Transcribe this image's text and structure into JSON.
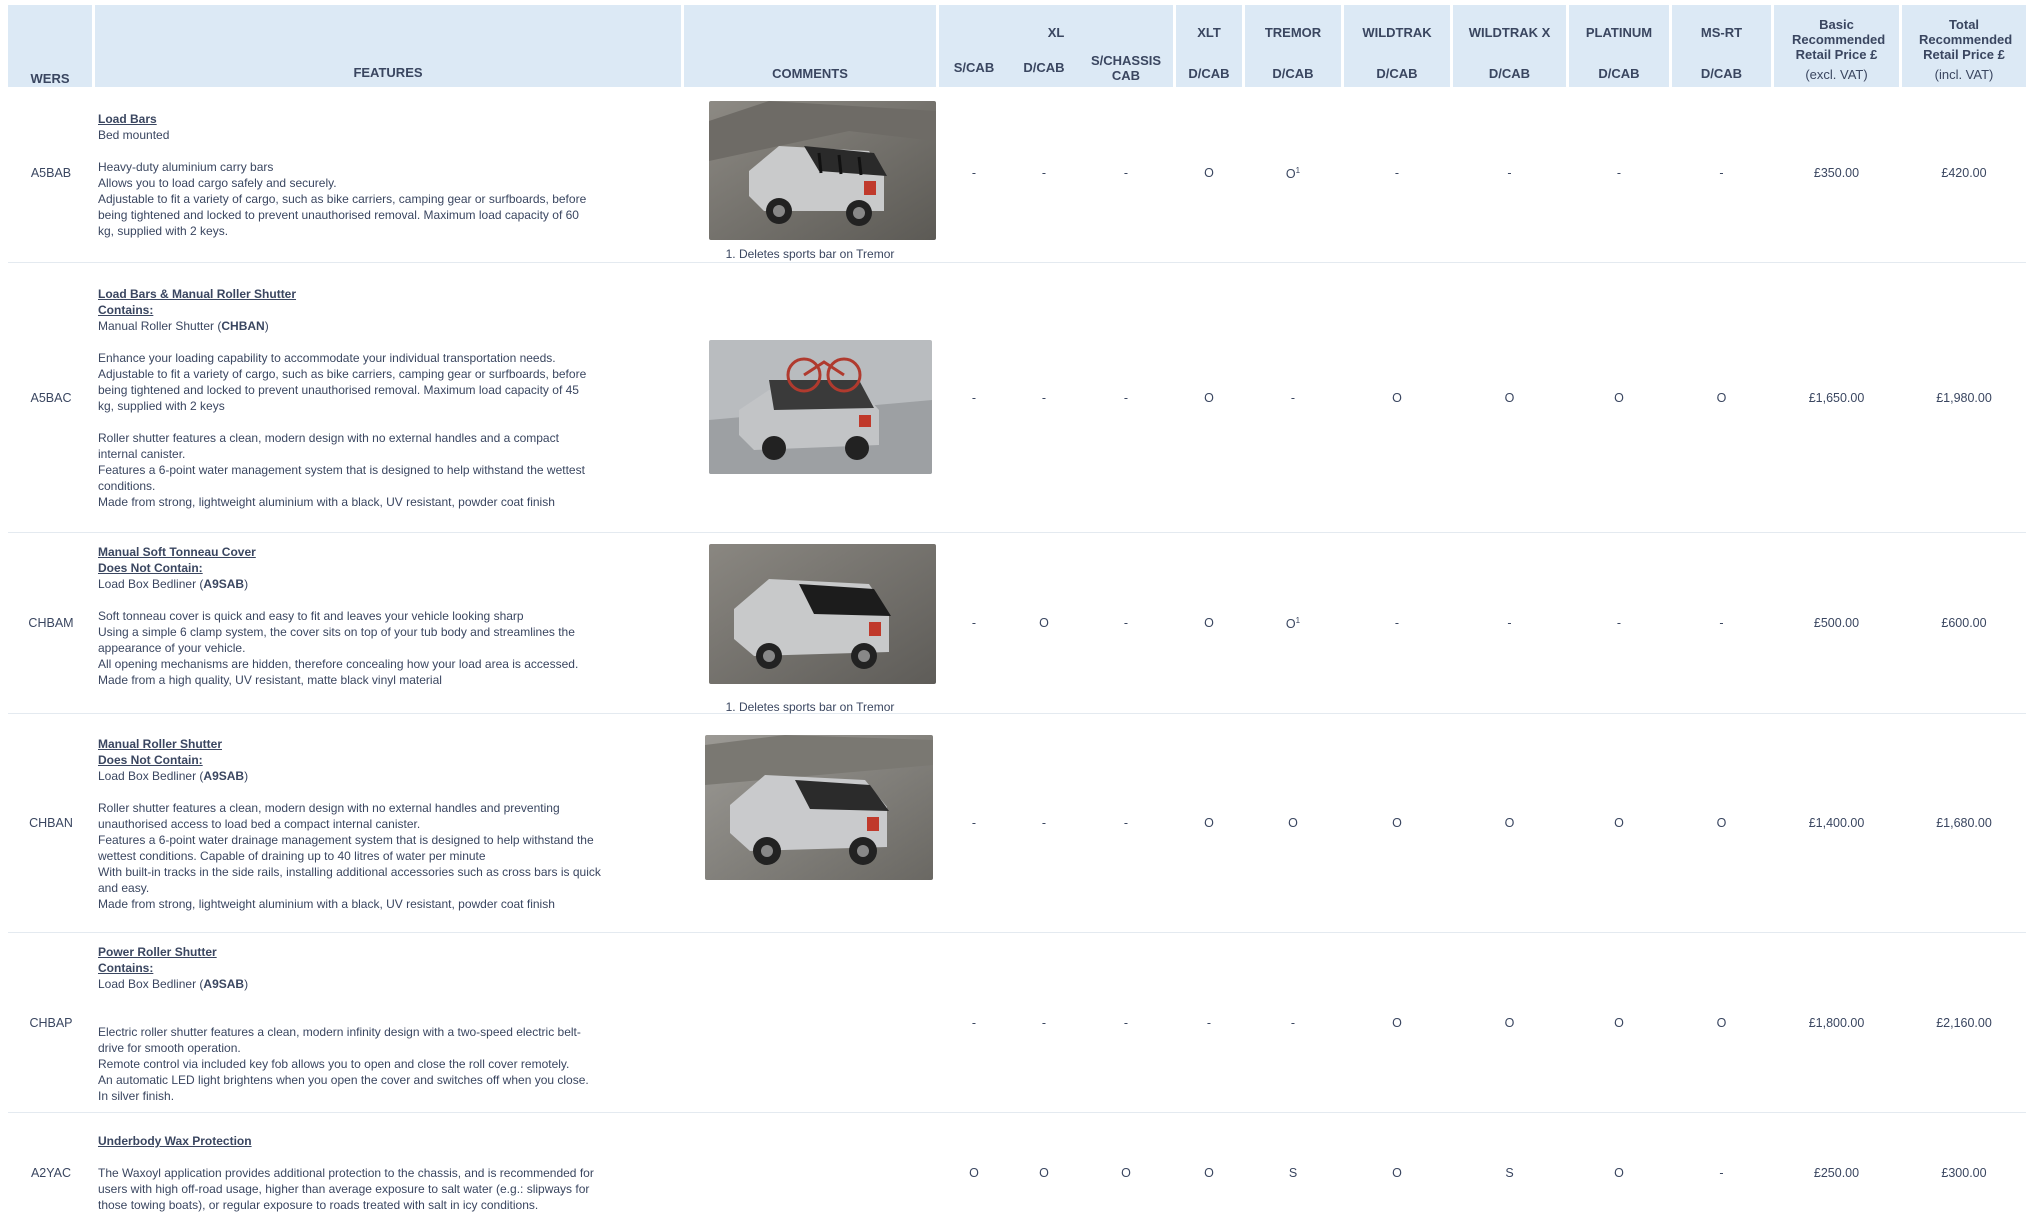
{
  "header": {
    "wers": "WERS",
    "features": "FEATURES",
    "comments": "COMMENTS",
    "xl": "XL",
    "xl_scab": "S/CAB",
    "xl_dcab": "D/CAB",
    "xl_schassis": "S/CHASSIS CAB",
    "xlt": "XLT",
    "xlt_sub": "D/CAB",
    "tremor": "TREMOR",
    "tremor_sub": "D/CAB",
    "wildtrak": "WILDTRAK",
    "wildtrak_sub": "D/CAB",
    "wildtrakx": "WILDTRAK X",
    "wildtrakx_sub": "D/CAB",
    "platinum": "PLATINUM",
    "platinum_sub": "D/CAB",
    "msrt": "MS-RT",
    "msrt_sub": "D/CAB",
    "basic_price": "Basic Recommended Retail Price £",
    "basic_price_note": "(excl. VAT)",
    "total_price": "Total Recommended Retail Price £",
    "total_price_note": "(incl. VAT)"
  },
  "rows": [
    {
      "wers": "A5BAB",
      "title": "Load Bars",
      "l1": "Bed mounted",
      "p1": "Heavy-duty aluminium carry bars",
      "p2": "Allows you to load cargo safely and securely.",
      "p3": "Adjustable to fit a variety of cargo, such as bike carriers, camping gear or surfboards, before",
      "p4": "being tightened and locked to prevent unauthorised removal. Maximum load capacity of 60",
      "p5": "kg, supplied with 2 keys.",
      "caption": "1. Deletes sports bar on Tremor",
      "v": [
        "-",
        "-",
        "-",
        "O",
        "O",
        "-",
        "-",
        "-",
        "-"
      ],
      "sup_tremor": "1",
      "basic": "£350.00",
      "total": "£420.00"
    },
    {
      "wers": "A5BAC",
      "title": "Load Bars & Manual Roller Shutter",
      "contains": "Contains:",
      "l1a": "Manual Roller Shutter (",
      "l1b": "CHBAN",
      "l1c": ")",
      "p1": "Enhance your loading capability to accommodate your individual transportation needs.",
      "p2": "Adjustable to fit a variety of cargo, such as bike carriers, camping gear or surfboards, before",
      "p3": "being tightened and locked to prevent unauthorised removal. Maximum load capacity of 45",
      "p4": "kg,  supplied  with 2 keys",
      "p5": "Roller shutter features a clean, modern design with no external handles and a compact",
      "p6": "internal canister.",
      "p7": "Features a 6-point water management system that is designed to help withstand the wettest",
      "p8": "conditions.",
      "p9": "Made from strong, lightweight aluminium with a black, UV resistant, powder coat finish",
      "v": [
        "-",
        "-",
        "-",
        "O",
        "-",
        "O",
        "O",
        "O",
        "O"
      ],
      "basic": "£1,650.00",
      "total": "£1,980.00"
    },
    {
      "wers": "CHBAM",
      "title": "Manual Soft Tonneau Cover",
      "contains": "Does Not Contain:",
      "l1a": "Load Box Bedliner (",
      "l1b": "A9SAB",
      "l1c": ")",
      "p1": "Soft tonneau cover is quick and easy to fit and leaves your vehicle looking sharp",
      "p2": "Using a simple 6 clamp system, the cover sits on top of your tub body and streamlines the",
      "p3": "appearance of your vehicle.",
      "p4": "All opening mechanisms are hidden, therefore concealing how your load area is accessed.",
      "p5": "Made from a high quality, UV resistant, matte black vinyl material",
      "caption": "1. Deletes sports bar on Tremor",
      "v": [
        "-",
        "O",
        "-",
        "O",
        "O",
        "-",
        "-",
        "-",
        "-"
      ],
      "sup_tremor": "1",
      "basic": "£500.00",
      "total": "£600.00"
    },
    {
      "wers": "CHBAN",
      "title": "Manual Roller Shutter",
      "contains": "Does Not Contain:",
      "l1a": "Load Box Bedliner (",
      "l1b": "A9SAB",
      "l1c": ")",
      "p1": "Roller shutter features a clean, modern design with no external handles and preventing",
      "p2": "unauthorised access to load bed a compact internal canister.",
      "p3": "Features a 6-point water drainage management system that is designed to help withstand the",
      "p4": "wettest conditions. Capable of draining up to 40 litres of water per minute",
      "p5": "With built-in tracks in the side rails, installing additional accessories such as cross bars is quick",
      "p6": "and easy.",
      "p7": "Made from strong, lightweight aluminium with a black, UV resistant, powder coat finish",
      "v": [
        "-",
        "-",
        "-",
        "O",
        "O",
        "O",
        "O",
        "O",
        "O"
      ],
      "basic": "£1,400.00",
      "total": "£1,680.00"
    },
    {
      "wers": "CHBAP",
      "title": "Power Roller Shutter",
      "contains": "Contains:",
      "l1a": "Load Box Bedliner (",
      "l1b": "A9SAB",
      "l1c": ")",
      "p1": "Electric roller shutter features a clean, modern infinity design with a two-speed electric belt-",
      "p2": "drive for smooth operation.",
      "p3": "Remote control via included key fob allows you to open and close the roll cover remotely.",
      "p4": "An automatic LED light brightens when you open the cover and switches off when you close.",
      "p5": "In silver finish.",
      "v": [
        "-",
        "-",
        "-",
        "-",
        "-",
        "O",
        "O",
        "O",
        "O"
      ],
      "basic": "£1,800.00",
      "total": "£2,160.00"
    },
    {
      "wers": "A2YAC",
      "title": "Underbody Wax Protection",
      "p1": "The Waxoyl application provides additional protection to the chassis, and is recommended for",
      "p2": "users with high off-road usage, higher than average exposure to salt water (e.g.: slipways for",
      "p3": "those towing boats), or regular exposure to roads treated with salt in icy conditions.",
      "v": [
        "O",
        "O",
        "O",
        "O",
        "S",
        "O",
        "S",
        "O",
        "-"
      ],
      "basic": "£250.00",
      "total": "£300.00"
    }
  ],
  "colors": {
    "header_bg": "#dce9f5",
    "text": "#3a4660",
    "row_divider": "#e4eaf0"
  }
}
